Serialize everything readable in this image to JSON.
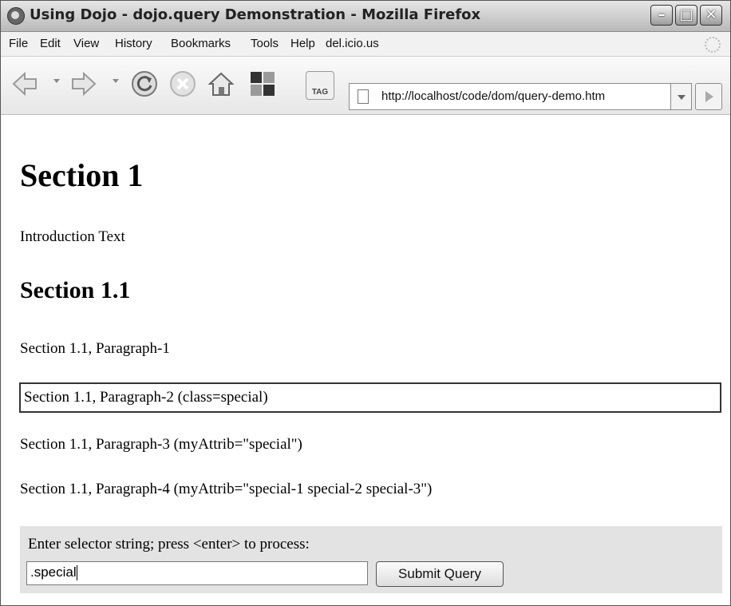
{
  "window": {
    "title": "Using Dojo - dojo.query Demonstration - Mozilla Firefox"
  },
  "menu": [
    "File",
    "Edit",
    "View",
    "History",
    "Bookmarks",
    "Tools",
    "Help",
    "del.icio.us"
  ],
  "toolbar": {
    "url": "http://localhost/code/dom/query-demo.htm",
    "tag_label": "TAG"
  },
  "page": {
    "h1": "Section 1",
    "intro": "Introduction Text",
    "h2": "Section 1.1",
    "p1": "Section 1.1, Paragraph-1",
    "p2": "Section 1.1, Paragraph-2 (class=special)",
    "p3": "Section 1.1, Paragraph-3 (myAttrib=\"special\")",
    "p4": "Section 1.1, Paragraph-4 (myAttrib=\"special-1 special-2 special-3\")",
    "query": {
      "label": "Enter selector string; press <enter> to process:",
      "value": ".special",
      "submit": "Submit Query"
    }
  },
  "icons": [
    "firefox-icon",
    "back-icon",
    "forward-icon",
    "reload-icon",
    "stop-icon",
    "home-icon",
    "dashboard-icon",
    "tag-icon",
    "page-icon",
    "go-icon",
    "activity-spinner-icon"
  ]
}
